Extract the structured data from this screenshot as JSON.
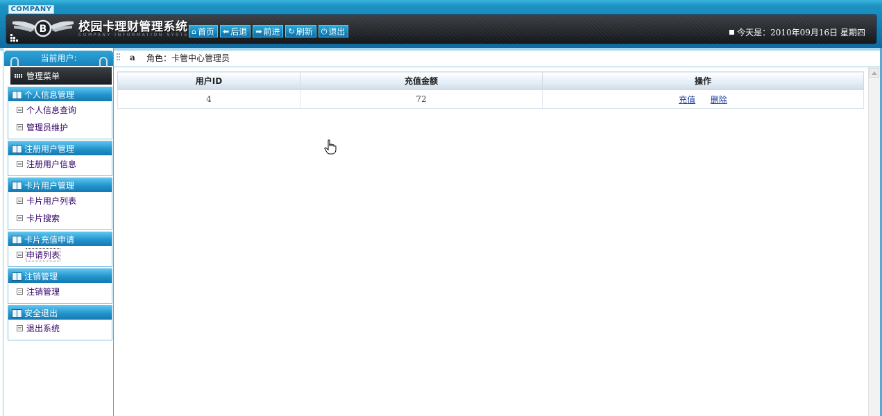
{
  "header": {
    "company_tag": "COMPANY",
    "title": "校园卡理财管理系统",
    "subtitle": "COMPANY INFORMATION SYSTEM",
    "nav": [
      {
        "label": "首页",
        "icon": "home-icon",
        "glyph": "⌂"
      },
      {
        "label": "后退",
        "icon": "arrow-left-icon",
        "glyph": "⬅"
      },
      {
        "label": "前进",
        "icon": "arrow-right-icon",
        "glyph": "➡"
      },
      {
        "label": "刷新",
        "icon": "refresh-icon",
        "glyph": "↻"
      },
      {
        "label": "退出",
        "icon": "power-icon",
        "glyph": "⏻"
      }
    ],
    "date_text": "今天是：2010年09月16日  星期四"
  },
  "sidebar": {
    "current_user_label": "当前用户:",
    "menu_title": "管理菜单",
    "groups": [
      {
        "title": "个人信息管理",
        "items": [
          "个人信息查询",
          "管理员维护"
        ]
      },
      {
        "title": "注册用户管理",
        "items": [
          "注册用户信息"
        ]
      },
      {
        "title": "卡片用户管理",
        "items": [
          "卡片用户列表",
          "卡片搜索"
        ]
      },
      {
        "title": "卡片充值申请",
        "items": [
          "申请列表"
        ]
      },
      {
        "title": "注销管理",
        "items": [
          "注销管理"
        ]
      },
      {
        "title": "安全退出",
        "items": [
          "退出系统"
        ]
      }
    ]
  },
  "breadcrumb": {
    "user": "a",
    "role": "角色：卡管中心管理员"
  },
  "table": {
    "headers": [
      "用户ID",
      "充值金额",
      "操作"
    ],
    "rows": [
      {
        "user_id": "4",
        "amount": "72",
        "actions": [
          "充值",
          "删除"
        ]
      }
    ]
  },
  "colors": {
    "banner_blue": "#1e93c4",
    "link": "#1a3e9a",
    "menu_item_text": "#330066"
  }
}
